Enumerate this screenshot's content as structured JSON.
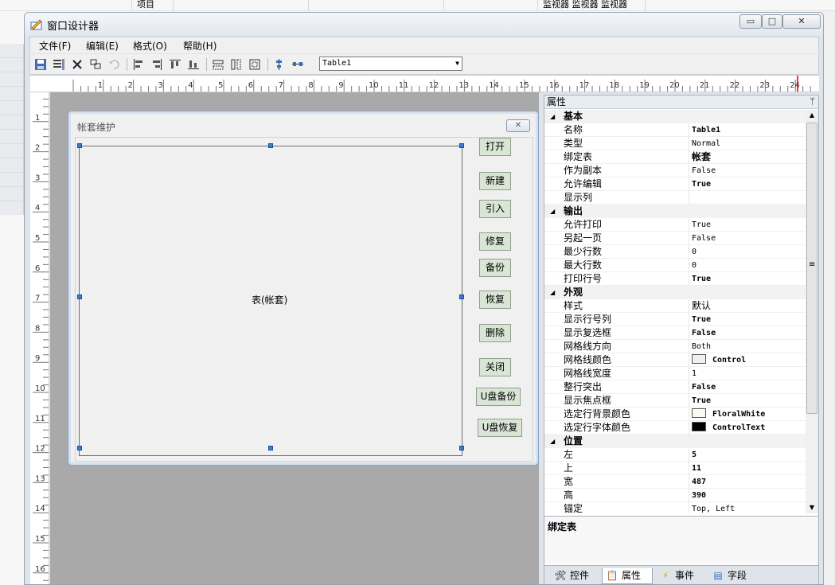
{
  "background": {
    "cell_label_1": "项目",
    "cell_label_2": "监视器 监视器 监视器"
  },
  "window": {
    "title": "窗口设计器",
    "min_glyph": "▭",
    "max_glyph": "□",
    "close_glyph": "✕"
  },
  "menu": [
    {
      "label": "文件(F)"
    },
    {
      "label": "编辑(E)"
    },
    {
      "label": "格式(O)"
    },
    {
      "label": "帮助(H)"
    }
  ],
  "toolbar": {
    "object_selector_value": "Table1",
    "arrow": "▼",
    "icons": [
      "save-icon",
      "properties-icon",
      "delete-icon",
      "copy-format-icon",
      "undo-icon",
      "align-left-icon",
      "align-right-icon",
      "align-top-icon",
      "align-bottom-icon",
      "same-width-icon",
      "same-height-icon",
      "same-size-icon",
      "center-vertical-icon",
      "center-horizontal-icon"
    ]
  },
  "rulers": {
    "horizontal_ticks": [
      "1",
      "2",
      "3",
      "4",
      "5",
      "6",
      "7",
      "8",
      "9",
      "10",
      "11",
      "12",
      "13",
      "14",
      "15",
      "16",
      "17",
      "18",
      "19",
      "20",
      "21",
      "22",
      "23",
      "24"
    ],
    "vertical_ticks": [
      "1",
      "2",
      "3",
      "4",
      "5",
      "6",
      "7",
      "8",
      "9",
      "10",
      "11",
      "12",
      "13",
      "14",
      "15",
      "16"
    ]
  },
  "form": {
    "title": "帐套维护",
    "close_glyph": "✕",
    "table_label": "表(帐套)",
    "buttons": [
      {
        "label": "打开"
      },
      {
        "label": "新建"
      },
      {
        "label": "引入"
      },
      {
        "label": "修复"
      },
      {
        "label": "备份"
      },
      {
        "label": "恢复"
      },
      {
        "label": "删除"
      },
      {
        "label": "关闭"
      },
      {
        "label": "U盘备份"
      },
      {
        "label": "U盘恢复"
      }
    ]
  },
  "properties": {
    "header": "属性",
    "pin_glyph": "ᛘ",
    "expand_glyph": "◢",
    "categories": [
      {
        "name": "基本",
        "rows": [
          {
            "name": "名称",
            "value": "Table1",
            "bold": true
          },
          {
            "name": "类型",
            "value": "Normal"
          },
          {
            "name": "绑定表",
            "value": "帐套",
            "bold": true,
            "cjk": true
          },
          {
            "name": "作为副本",
            "value": "False"
          },
          {
            "name": "允许编辑",
            "value": "True",
            "bold": true
          },
          {
            "name": "显示列",
            "value": ""
          }
        ]
      },
      {
        "name": "输出",
        "rows": [
          {
            "name": "允许打印",
            "value": "True"
          },
          {
            "name": "另起一页",
            "value": "False"
          },
          {
            "name": "最少行数",
            "value": "0"
          },
          {
            "name": "最大行数",
            "value": "0"
          },
          {
            "name": "打印行号",
            "value": "True",
            "bold": true
          }
        ]
      },
      {
        "name": "外观",
        "rows": [
          {
            "name": "样式",
            "value": "默认",
            "cjk": true
          },
          {
            "name": "显示行号列",
            "value": "True",
            "bold": true
          },
          {
            "name": "显示复选框",
            "value": "False",
            "bold": true
          },
          {
            "name": "网格线方向",
            "value": "Both"
          },
          {
            "name": "网格线颜色",
            "value": "Control",
            "bold": true,
            "swatch": "#f0f0f0"
          },
          {
            "name": "网格线宽度",
            "value": "1"
          },
          {
            "name": "整行突出",
            "value": "False",
            "bold": true
          },
          {
            "name": "显示焦点框",
            "value": "True",
            "bold": true
          },
          {
            "name": "选定行背景颜色",
            "value": "FloralWhite",
            "bold": true,
            "swatch": "#fffaf0"
          },
          {
            "name": "选定行字体颜色",
            "value": "ControlText",
            "bold": true,
            "swatch": "#000000"
          }
        ]
      },
      {
        "name": "位置",
        "rows": [
          {
            "name": "左",
            "value": "5",
            "bold": true
          },
          {
            "name": "上",
            "value": "11",
            "bold": true
          },
          {
            "name": "宽",
            "value": "487",
            "bold": true
          },
          {
            "name": "高",
            "value": "390",
            "bold": true
          },
          {
            "name": "锚定",
            "value": "Top, Left"
          }
        ]
      }
    ],
    "description_title": "绑定表",
    "tabs": [
      {
        "label": "控件",
        "icon": "🛠",
        "icon_name": "tools-icon"
      },
      {
        "label": "属性",
        "icon": "📋",
        "icon_name": "property-sheet-icon",
        "active": true
      },
      {
        "label": "事件",
        "icon": "⚡",
        "icon_name": "lightning-icon"
      },
      {
        "label": "字段",
        "icon": "▤",
        "icon_name": "field-list-icon"
      }
    ],
    "scroll_up": "▲",
    "scroll_down": "▼",
    "grip": "≡"
  }
}
